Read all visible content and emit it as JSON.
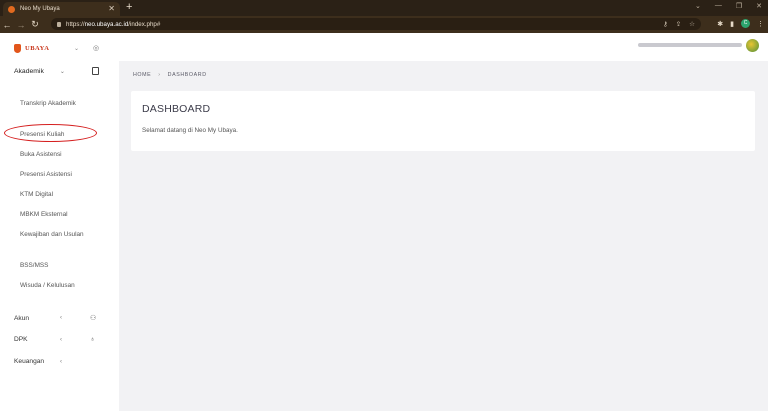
{
  "browser": {
    "tab_title": "Neo My Ubaya",
    "tab_close": "✕",
    "new_tab": "+",
    "url_scheme": "https://",
    "url_host": "neo.ubaya.ac.id",
    "url_path": "/index.php#",
    "profile_initial": "C"
  },
  "sidebar": {
    "brand": "UBAYA",
    "section": "Akademik",
    "items": [
      {
        "label": "Transkrip Akademik"
      },
      {
        "label": "Presensi Kuliah"
      },
      {
        "label": "Buka Asistensi"
      },
      {
        "label": "Presensi Asistensi"
      },
      {
        "label": "KTM Digital"
      },
      {
        "label": "MBKM Eksternal"
      },
      {
        "label": "Kewajiban dan Usulan"
      },
      {
        "label": "BSS/MSS"
      },
      {
        "label": "Wisuda / Kelulusan"
      }
    ],
    "groups": [
      {
        "label": "Akun",
        "chevron": "‹",
        "icon": "user-icon"
      },
      {
        "label": "DPK",
        "chevron": "‹",
        "icon": "award-icon"
      },
      {
        "label": "Keuangan",
        "chevron": "‹"
      }
    ]
  },
  "breadcrumb": {
    "home": "HOME",
    "separator": "›",
    "current": "DASHBOARD"
  },
  "dashboard": {
    "title": "DASHBOARD",
    "welcome": "Selamat datang di Neo My Ubaya."
  },
  "colors": {
    "brand": "#c8351a",
    "highlight_ring": "#d52020",
    "page_bg": "#f2f2f4"
  }
}
